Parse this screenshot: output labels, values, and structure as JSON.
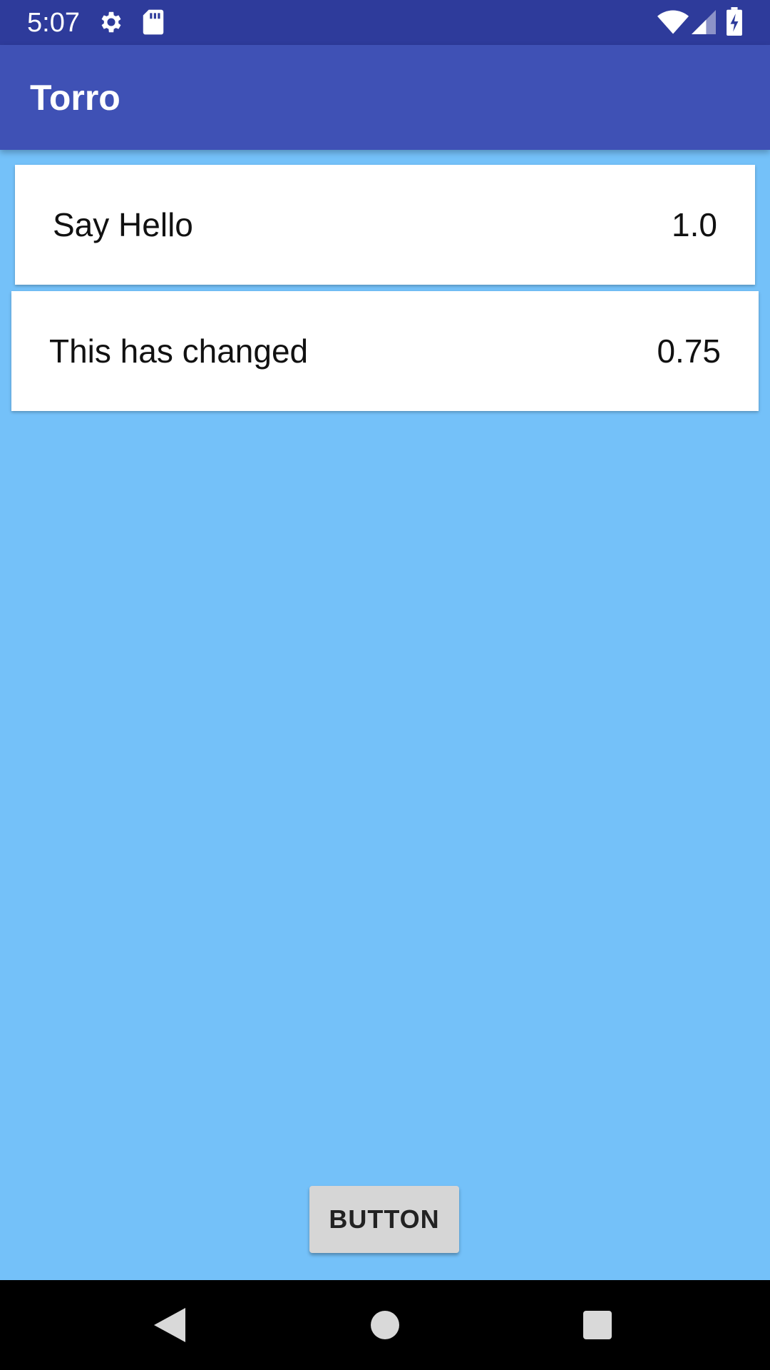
{
  "status_bar": {
    "time": "5:07",
    "icons": [
      "gear-icon",
      "sd-card-icon",
      "wifi-icon",
      "signal-icon",
      "battery-charging-icon"
    ]
  },
  "app_bar": {
    "title": "Torro"
  },
  "list": {
    "items": [
      {
        "label": "Say Hello",
        "value": "1.0"
      },
      {
        "label": "This has changed",
        "value": "0.75"
      }
    ]
  },
  "main": {
    "button_label": "BUTTON"
  },
  "nav_bar": {
    "icons": [
      "back-icon",
      "home-icon",
      "recents-icon"
    ]
  },
  "colors": {
    "status_bar": "#2e3b9b",
    "app_bar": "#3f51b5",
    "background": "#74c1f9",
    "button": "#d6d6d6"
  }
}
